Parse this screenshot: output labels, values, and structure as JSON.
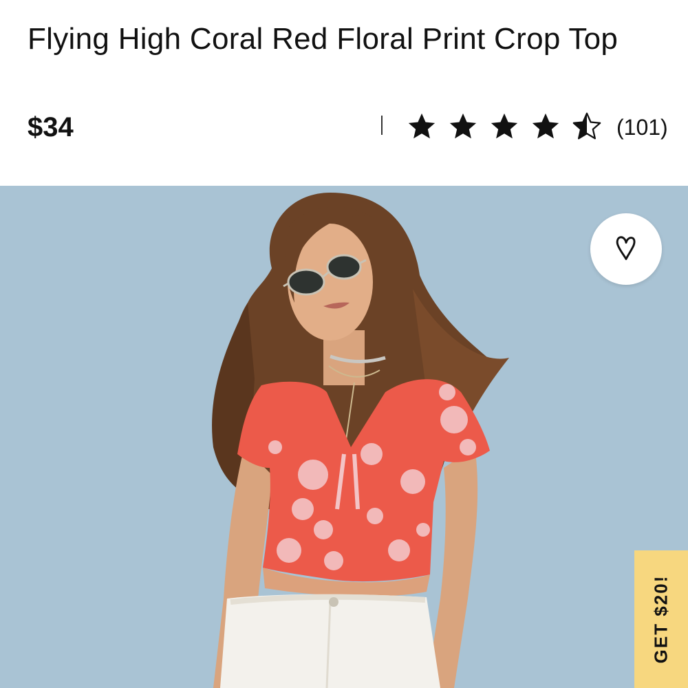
{
  "product": {
    "title": "Flying High Coral Red Floral Print Crop Top",
    "price": "$34",
    "rating": 4.5,
    "rating_max": 5,
    "review_count": "(101)"
  },
  "actions": {
    "favorite_icon": "heart-outline-icon"
  },
  "promo": {
    "label": "GET $20!"
  },
  "colors": {
    "hero_background": "#a9c3d4",
    "promo_background": "#f7d77f",
    "top_color": "#ec5a4a"
  }
}
